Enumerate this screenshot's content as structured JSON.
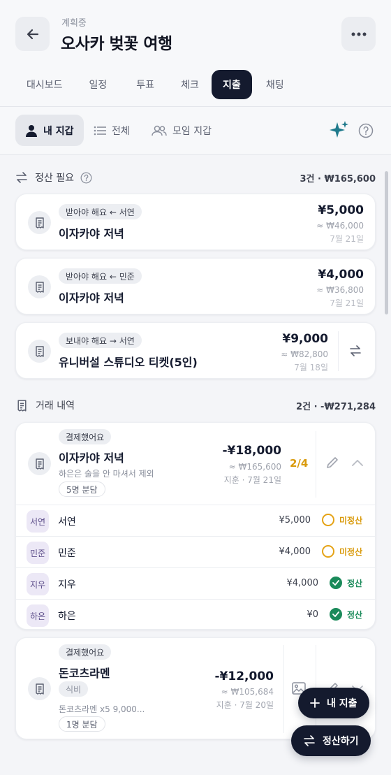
{
  "header": {
    "status": "계획중",
    "title": "오사카 벚꽃 여행"
  },
  "tabs": [
    "대시보드",
    "일정",
    "투표",
    "체크",
    "지출",
    "채팅"
  ],
  "active_tab": "지출",
  "filters": {
    "my_wallet": "내 지갑",
    "all": "전체",
    "group_wallet": "모임 지갑"
  },
  "settlement": {
    "title": "정산 필요",
    "summary": "3건 · ₩165,600",
    "items": [
      {
        "chip": "받아야 해요 ← 서연",
        "title": "이자카야 저녁",
        "amount": "¥5,000",
        "converted": "≈ ₩46,000",
        "date": "7월 21일"
      },
      {
        "chip": "받아야 해요 ← 민준",
        "title": "이자카야 저녁",
        "amount": "¥4,000",
        "converted": "≈ ₩36,800",
        "date": "7월 21일"
      },
      {
        "chip": "보내야 해요 → 서연",
        "title": "유니버설 스튜디오 티켓(5인)",
        "amount": "¥9,000",
        "converted": "≈ ₩82,800",
        "date": "7월 18일"
      }
    ]
  },
  "transactions": {
    "title": "거래 내역",
    "summary": "2건 · -₩271,284",
    "items": [
      {
        "chip": "결제했어요",
        "title": "이자카야 저녁",
        "note": "하은은 술을 안 마셔서 제외",
        "split": "5명 분담",
        "amount": "-¥18,000",
        "converted": "≈ ₩165,600",
        "meta": "지훈 · 7월 21일",
        "progress": "2/4",
        "members": [
          {
            "avatar": "서연",
            "name": "서연",
            "amount": "¥5,000",
            "status": "미정산"
          },
          {
            "avatar": "민준",
            "name": "민준",
            "amount": "¥4,000",
            "status": "미정산"
          },
          {
            "avatar": "지우",
            "name": "지우",
            "amount": "¥4,000",
            "status": "정산"
          },
          {
            "avatar": "하은",
            "name": "하은",
            "amount": "¥0",
            "status": "정산"
          }
        ]
      },
      {
        "chip": "결제했어요",
        "title": "돈코츠라멘",
        "category": "식비",
        "note": "돈코츠라멘 x5  9,000...",
        "split": "1명 분담",
        "amount": "-¥12,000",
        "converted": "≈ ₩105,684",
        "meta": "지훈 · 7월 20일"
      }
    ]
  },
  "fab": {
    "add_expense": "내 지출",
    "settle": "정산하기"
  },
  "colors": {
    "primary": "#141a2e",
    "pending": "#e5a317",
    "done": "#1a8a5a",
    "progress": "#d99a0b",
    "sparkle": "#1f7a8c"
  }
}
